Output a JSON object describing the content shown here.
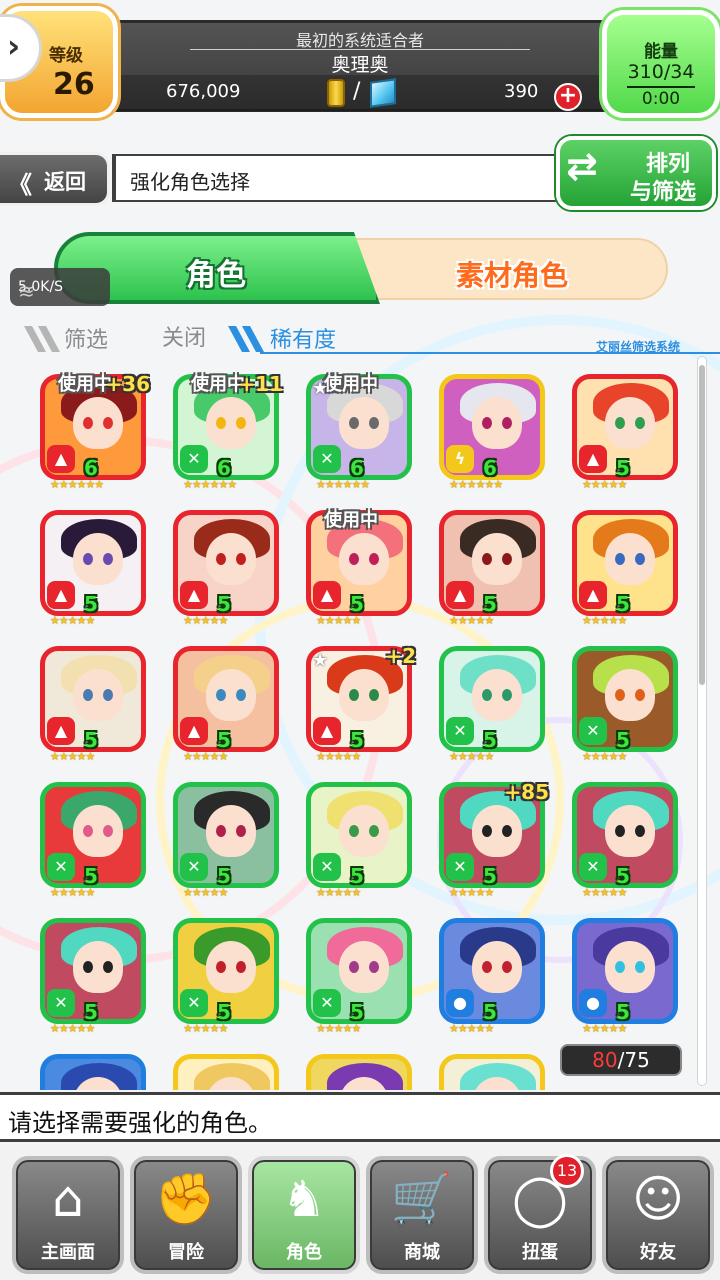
{
  "header": {
    "level_label": "等级",
    "level_value": "26",
    "subtitle": "最初的系统适合者",
    "player_name": "奥理奥",
    "coins": "676,009",
    "slash": "/",
    "gems": "390",
    "plus": "+",
    "energy_label": "能量",
    "energy_value": "310/34",
    "energy_timer": "0:00"
  },
  "nav_header": {
    "back_chevron": "《",
    "back_label": "返回",
    "title": "强化角色选择",
    "sort_line1": "排列",
    "sort_line2": "与筛选"
  },
  "network": {
    "speed": "5.0K/S"
  },
  "tabs": {
    "characters": "角色",
    "materials": "素材角色"
  },
  "filter": {
    "label": "筛选",
    "value": "关闭",
    "sort_label": "稀有度",
    "system_name": "艾丽丝筛选系统"
  },
  "colors": {
    "fire": "#e8242c",
    "wind": "#22c24a",
    "dark": "#f4c81a",
    "water": "#1f7ee0",
    "accent_green": "#2ec24e",
    "accent_orange": "#ff6a1c"
  },
  "characters": [
    {
      "frame": "fire",
      "elem": "fire",
      "level": "6",
      "stars": "★★★★★★",
      "in_use": "使用中",
      "bonus": "+36",
      "hair": "#8b1a1a",
      "eye": "#e02f2f",
      "bg": "#ff9a3c"
    },
    {
      "frame": "wind",
      "elem": "wind",
      "level": "6",
      "stars": "★★★★★★",
      "in_use": "使用中",
      "bonus": "+11",
      "hair": "#48c96a",
      "eye": "#f3b511",
      "bg": "#d3f5d3"
    },
    {
      "frame": "wind",
      "elem": "wind",
      "level": "6",
      "stars": "★★★★★★",
      "in_use": "使用中",
      "bonus": "",
      "fav": true,
      "hair": "#d8d8d8",
      "eye": "#6a6a6a",
      "bg": "#c7b4e8"
    },
    {
      "frame": "dark",
      "elem": "dark",
      "level": "6",
      "stars": "★★★★★★",
      "in_use": "",
      "bonus": "",
      "hair": "#e6e6ee",
      "eye": "#b02060",
      "bg": "#d060c0"
    },
    {
      "frame": "fire",
      "elem": "fire",
      "level": "5",
      "stars": "★★★★★",
      "in_use": "",
      "bonus": "",
      "hair": "#e8442a",
      "eye": "#2f9e4f",
      "bg": "#ffe1b0"
    },
    {
      "frame": "fire",
      "elem": "fire",
      "level": "5",
      "stars": "★★★★★",
      "in_use": "",
      "bonus": "",
      "hair": "#2a1a3a",
      "eye": "#6a4ab0",
      "bg": "#f4f0f4"
    },
    {
      "frame": "fire",
      "elem": "fire",
      "level": "5",
      "stars": "★★★★★",
      "in_use": "",
      "bonus": "",
      "hair": "#9a2a1a",
      "eye": "#c02020",
      "bg": "#f8d4c8"
    },
    {
      "frame": "fire",
      "elem": "fire",
      "level": "5",
      "stars": "★★★★★",
      "in_use": "使用中",
      "bonus": "",
      "hair": "#f4707a",
      "eye": "#c0205a",
      "bg": "#ffd0a0"
    },
    {
      "frame": "fire",
      "elem": "fire",
      "level": "5",
      "stars": "★★★★★",
      "in_use": "",
      "bonus": "",
      "hair": "#3a2a24",
      "eye": "#8a1a1a",
      "bg": "#f0c0b0"
    },
    {
      "frame": "fire",
      "elem": "fire",
      "level": "5",
      "stars": "★★★★★",
      "in_use": "",
      "bonus": "",
      "hair": "#e47a1a",
      "eye": "#3a6ac0",
      "bg": "#ffe38c"
    },
    {
      "frame": "fire",
      "elem": "fire",
      "level": "5",
      "stars": "★★★★★",
      "in_use": "",
      "bonus": "",
      "hair": "#f2e0b0",
      "eye": "#4a7ab0",
      "bg": "#f0e8d8"
    },
    {
      "frame": "fire",
      "elem": "fire",
      "level": "5",
      "stars": "★★★★★",
      "in_use": "",
      "bonus": "",
      "hair": "#f4d08a",
      "eye": "#3a8ac0",
      "bg": "#f4c0a0"
    },
    {
      "frame": "fire",
      "elem": "fire",
      "level": "5",
      "stars": "★★★★★",
      "in_use": "",
      "bonus": "+2",
      "fav": true,
      "hair": "#d83a1a",
      "eye": "#2a8a4a",
      "bg": "#f8f0e0"
    },
    {
      "frame": "wind",
      "elem": "wind",
      "level": "5",
      "stars": "★★★★★",
      "in_use": "",
      "bonus": "",
      "hair": "#6fe0c8",
      "eye": "#2a9a6a",
      "bg": "#d8f4e8"
    },
    {
      "frame": "wind",
      "elem": "wind",
      "level": "5",
      "stars": "★★★★★",
      "in_use": "",
      "bonus": "",
      "hair": "#b8e04a",
      "eye": "#e0601a",
      "bg": "#9a5a2a"
    },
    {
      "frame": "wind",
      "elem": "wind",
      "level": "5",
      "stars": "★★★★★",
      "in_use": "",
      "bonus": "",
      "hair": "#3aa86a",
      "eye": "#e05a8a",
      "bg": "#e83a3a"
    },
    {
      "frame": "wind",
      "elem": "wind",
      "level": "5",
      "stars": "★★★★★",
      "in_use": "",
      "bonus": "",
      "hair": "#2a2a2a",
      "eye": "#b0204a",
      "bg": "#8ac0a0"
    },
    {
      "frame": "wind",
      "elem": "wind",
      "level": "5",
      "stars": "★★★★★",
      "in_use": "",
      "bonus": "",
      "hair": "#f0e070",
      "eye": "#3a9a4a",
      "bg": "#e8f4c8"
    },
    {
      "frame": "wind",
      "elem": "wind",
      "level": "5",
      "stars": "★★★★★",
      "in_use": "",
      "bonus": "+85",
      "hair": "#50d8c0",
      "eye": "#222222",
      "bg": "#c04a60"
    },
    {
      "frame": "wind",
      "elem": "wind",
      "level": "5",
      "stars": "★★★★★",
      "in_use": "",
      "bonus": "",
      "hair": "#50d8c0",
      "eye": "#222222",
      "bg": "#c04a60"
    },
    {
      "frame": "wind",
      "elem": "wind",
      "level": "5",
      "stars": "★★★★★",
      "in_use": "",
      "bonus": "",
      "hair": "#50d8c0",
      "eye": "#222222",
      "bg": "#c04a60"
    },
    {
      "frame": "wind",
      "elem": "wind",
      "level": "5",
      "stars": "★★★★★",
      "in_use": "",
      "bonus": "",
      "hair": "#3a9a2a",
      "eye": "#c0202a",
      "bg": "#f0d040"
    },
    {
      "frame": "wind",
      "elem": "wind",
      "level": "5",
      "stars": "★★★★★",
      "in_use": "",
      "bonus": "",
      "hair": "#f06a9a",
      "eye": "#a03a8a",
      "bg": "#9ae0b0"
    },
    {
      "frame": "water",
      "elem": "water",
      "level": "5",
      "stars": "★★★★★",
      "in_use": "",
      "bonus": "",
      "hair": "#2a3a8a",
      "eye": "#c02030",
      "bg": "#6a8ae0"
    },
    {
      "frame": "water",
      "elem": "water",
      "level": "5",
      "stars": "★★★★★",
      "in_use": "",
      "bonus": "",
      "hair": "#4a3aa0",
      "eye": "#30c0e0",
      "bg": "#7a6ad0"
    },
    {
      "frame": "water",
      "elem": "water",
      "level": "",
      "stars": "",
      "in_use": "",
      "bonus": "",
      "hair": "#2a4ab0",
      "eye": "#222222",
      "bg": "#4a8ae0"
    },
    {
      "frame": "dark",
      "elem": "dark",
      "level": "",
      "stars": "",
      "in_use": "",
      "bonus": "",
      "hair": "#f0c860",
      "eye": "#222222",
      "bg": "#fff0c0"
    },
    {
      "frame": "dark",
      "elem": "dark",
      "level": "",
      "stars": "",
      "in_use": "",
      "bonus": "",
      "hair": "#7a3ab0",
      "eye": "#222222",
      "bg": "#f0d860"
    },
    {
      "frame": "dark",
      "elem": "dark",
      "level": "",
      "stars": "",
      "in_use": "",
      "bonus": "",
      "hair": "#6ae0d0",
      "eye": "#222222",
      "bg": "#f4f0d8"
    }
  ],
  "element_icons": {
    "fire": "▲",
    "wind": "✕",
    "dark": "ϟ",
    "water": "●"
  },
  "count": {
    "current": "80",
    "max": "/75"
  },
  "message": "请选择需要强化的角色。",
  "bottom_nav": [
    {
      "label": "主画面",
      "icon": "⌂",
      "name": "home"
    },
    {
      "label": "冒险",
      "icon": "✊",
      "name": "adventure"
    },
    {
      "label": "角色",
      "icon": "♞",
      "name": "characters",
      "active": true
    },
    {
      "label": "商城",
      "icon": "🛒",
      "name": "shop"
    },
    {
      "label": "扭蛋",
      "icon": "◯",
      "name": "gacha",
      "badge": "13"
    },
    {
      "label": "好友",
      "icon": "☺",
      "name": "friends"
    }
  ]
}
